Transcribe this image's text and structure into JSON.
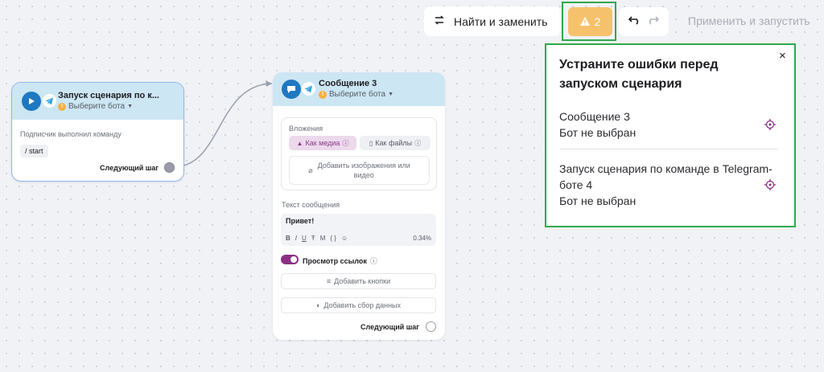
{
  "toolbar": {
    "find_replace_label": "Найти и заменить",
    "warnings_count": "2",
    "apply_run_label": "Применить и запустить"
  },
  "errors_panel": {
    "title": "Устраните ошибки перед запуском сценария",
    "close_glyph": "×",
    "items": [
      {
        "name": "Сообщение 3",
        "message": "Бот не выбран"
      },
      {
        "name": "Запуск сценария по команде в Telegram-боте 4",
        "message": "Бот не выбран"
      }
    ]
  },
  "node_start": {
    "title": "Запуск сценария по к...",
    "bot_placeholder": "Выберите бота",
    "trigger_label": "Подписчик выполнил команду",
    "command": "/ start",
    "next_step": "Следующий шаг"
  },
  "node_message": {
    "title": "Сообщение 3",
    "bot_placeholder": "Выберите бота",
    "attachments_label": "Вложения",
    "as_media": "Как медиа",
    "as_files": "Как файлы",
    "add_media_line1": "Добавить изображения или",
    "add_media_line2": "видео",
    "text_label": "Текст сообщения",
    "message_text": "Привет!",
    "format_tools": [
      "B",
      "I",
      "U",
      "Ŧ",
      "M",
      "{ }",
      "☺"
    ],
    "char_usage": "0.34%",
    "link_preview_label": "Просмотр ссылок",
    "add_buttons": "Добавить кнопки",
    "add_data_collection": "Добавить сбор данных",
    "next_step": "Следующий шаг"
  },
  "colors": {
    "accent_blue": "#1e78c2",
    "node_header": "#cde6f4",
    "warning": "#f5c26b",
    "highlight_green": "#2fa84f",
    "toggle_on": "#8b2f86"
  }
}
